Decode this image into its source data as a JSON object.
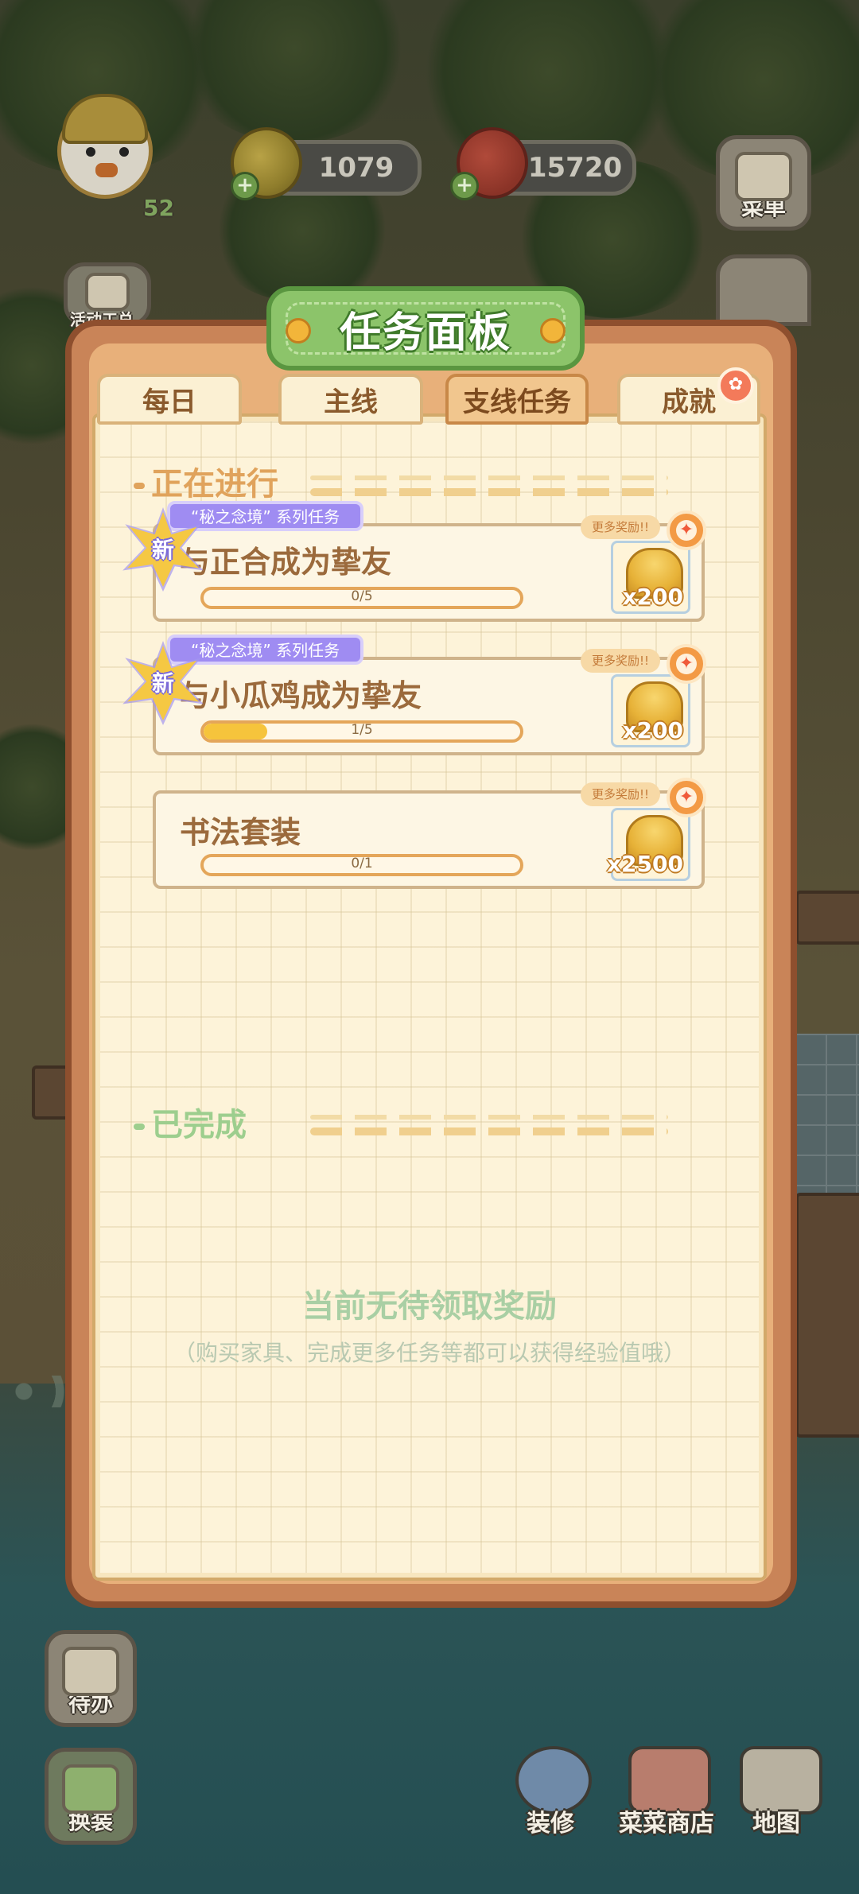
{
  "hud": {
    "level": "52",
    "coins": "1079",
    "food": "15720"
  },
  "side_buttons": {
    "menu": "菜单",
    "activity_partial": "活动工总",
    "todo": "待办",
    "dress": "换装"
  },
  "bottom_bar": [
    {
      "label": "装修"
    },
    {
      "label": "菜菜商店"
    },
    {
      "label": "地图"
    }
  ],
  "panel": {
    "title": "任务面板",
    "tabs": [
      {
        "label": "每日",
        "active": false
      },
      {
        "label": "主线",
        "active": false
      },
      {
        "label": "支线任务",
        "active": true
      },
      {
        "label": "成就",
        "active": false,
        "badge": "✿"
      }
    ],
    "in_progress_header": "正在进行",
    "completed_header": "已完成",
    "tasks": [
      {
        "series_tag": "“秘之念境” 系列任务",
        "new_badge": "新",
        "name": "与正合成为挚友",
        "progress_text": "0/5",
        "progress": 0.0,
        "more_rewards": "更多奖励!!",
        "reward_amount": "x200"
      },
      {
        "series_tag": "“秘之念境” 系列任务",
        "new_badge": "新",
        "name": "与小瓜鸡成为挚友",
        "progress_text": "1/5",
        "progress": 0.2,
        "more_rewards": "更多奖励!!",
        "reward_amount": "x200"
      },
      {
        "name": "书法套装",
        "progress_text": "0/1",
        "progress": 0.0,
        "more_rewards": "更多奖励!!",
        "reward_amount": "x2500"
      }
    ],
    "empty_message": "当前无待领取奖励",
    "empty_hint": "（购买家具、完成更多任务等都可以获得经验值哦）"
  },
  "colors": {
    "in_progress": "#e0a35c",
    "completed": "#9dce8e",
    "panel_frame": "#c98458",
    "title_green": "#8cc46a"
  }
}
